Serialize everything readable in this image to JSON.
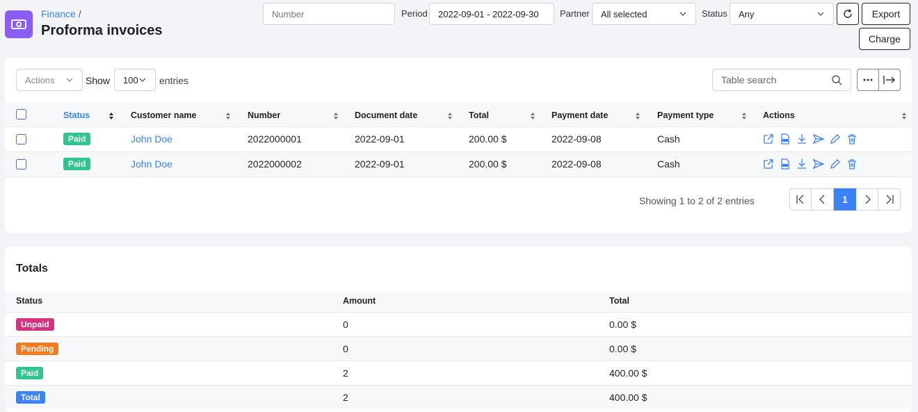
{
  "header": {
    "breadcrumb": "Finance",
    "breadcrumb_sep": "/",
    "title": "Proforma invoices"
  },
  "filters": {
    "number_placeholder": "Number",
    "period_label": "Period",
    "period_value": "2022-09-01 - 2022-09-30",
    "partner_label": "Partner",
    "partner_value": "All selected",
    "status_label": "Status",
    "status_value": "Any",
    "export_label": "Export",
    "charge_label": "Charge"
  },
  "toolbar": {
    "actions_label": "Actions",
    "show_label": "Show",
    "entries_value": "100",
    "entries_label": "entries",
    "search_placeholder": "Table search"
  },
  "table": {
    "columns": [
      "Status",
      "Customer name",
      "Number",
      "Document date",
      "Total",
      "Payment date",
      "Payment type",
      "Actions"
    ],
    "rows": [
      {
        "status": "Paid",
        "customer": "John Doe",
        "number": "2022000001",
        "document_date": "2022-09-01",
        "total": "200.00 $",
        "payment_date": "2022-09-08",
        "payment_type": "Cash"
      },
      {
        "status": "Paid",
        "customer": "John Doe",
        "number": "2022000002",
        "document_date": "2022-09-01",
        "total": "200.00 $",
        "payment_date": "2022-09-08",
        "payment_type": "Cash"
      }
    ],
    "info": "Showing 1 to 2 of 2 entries",
    "current_page": "1"
  },
  "totals": {
    "title": "Totals",
    "columns": [
      "Status",
      "Amount",
      "Total"
    ],
    "rows": [
      {
        "status": "Unpaid",
        "amount": "0",
        "total": "0.00 $",
        "color": "#d6317f"
      },
      {
        "status": "Pending",
        "amount": "0",
        "total": "0.00 $",
        "color": "#f47c20"
      },
      {
        "status": "Paid",
        "amount": "2",
        "total": "400.00 $",
        "color": "#2fc58e"
      },
      {
        "status": "Total",
        "amount": "2",
        "total": "400.00 $",
        "color": "#3b82f6"
      }
    ]
  },
  "colors": {
    "accent": "#3b82f6",
    "app_icon": "#8b5cf6",
    "paid": "#2fc58e"
  }
}
